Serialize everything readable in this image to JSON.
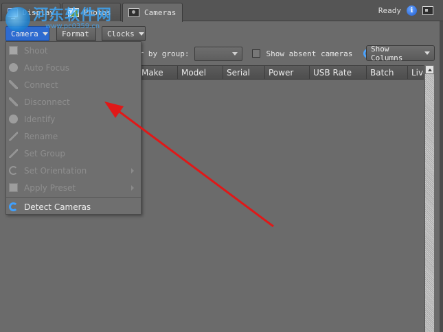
{
  "tabs": [
    {
      "label": "Display",
      "icon": "display-icon",
      "active": false
    },
    {
      "label": "Photos",
      "icon": "photos-icon",
      "active": false
    },
    {
      "label": "Cameras",
      "icon": "cameras-icon",
      "active": true
    }
  ],
  "status": {
    "text": "Ready"
  },
  "watermark": {
    "main": "河东软件网",
    "sub": "www.pc0359.cn"
  },
  "toolbar": {
    "camera": "Camera",
    "format": "Format",
    "clocks": "Clocks"
  },
  "filter": {
    "label": "er by group:",
    "show_absent": "Show absent cameras",
    "show_columns": "Show Columns"
  },
  "table": {
    "columns": [
      "Make",
      "Model",
      "Serial",
      "Power",
      "USB Rate",
      "Batch",
      "Live"
    ]
  },
  "menu": {
    "items": [
      {
        "label": "Shoot",
        "icon": "shoot-icon",
        "enabled": false
      },
      {
        "label": "Auto Focus",
        "icon": "focus-icon",
        "enabled": false
      },
      {
        "label": "Connect",
        "icon": "connect-icon",
        "enabled": false
      },
      {
        "label": "Disconnect",
        "icon": "disconnect-icon",
        "enabled": false
      },
      {
        "label": "Identify",
        "icon": "help-icon",
        "enabled": false
      },
      {
        "label": "Rename",
        "icon": "edit-icon",
        "enabled": false
      },
      {
        "label": "Set Group",
        "icon": "edit-icon",
        "enabled": false
      },
      {
        "label": "Set Orientation",
        "icon": "rotate-icon",
        "enabled": false
      },
      {
        "label": "Apply Preset",
        "icon": "preset-icon",
        "enabled": false
      },
      {
        "label": "Detect Cameras",
        "icon": "refresh-icon",
        "enabled": true
      }
    ]
  },
  "colors": {
    "background": "#6b6b6b",
    "accent": "#2e6bd0",
    "annotation_arrow": "#e01818"
  }
}
